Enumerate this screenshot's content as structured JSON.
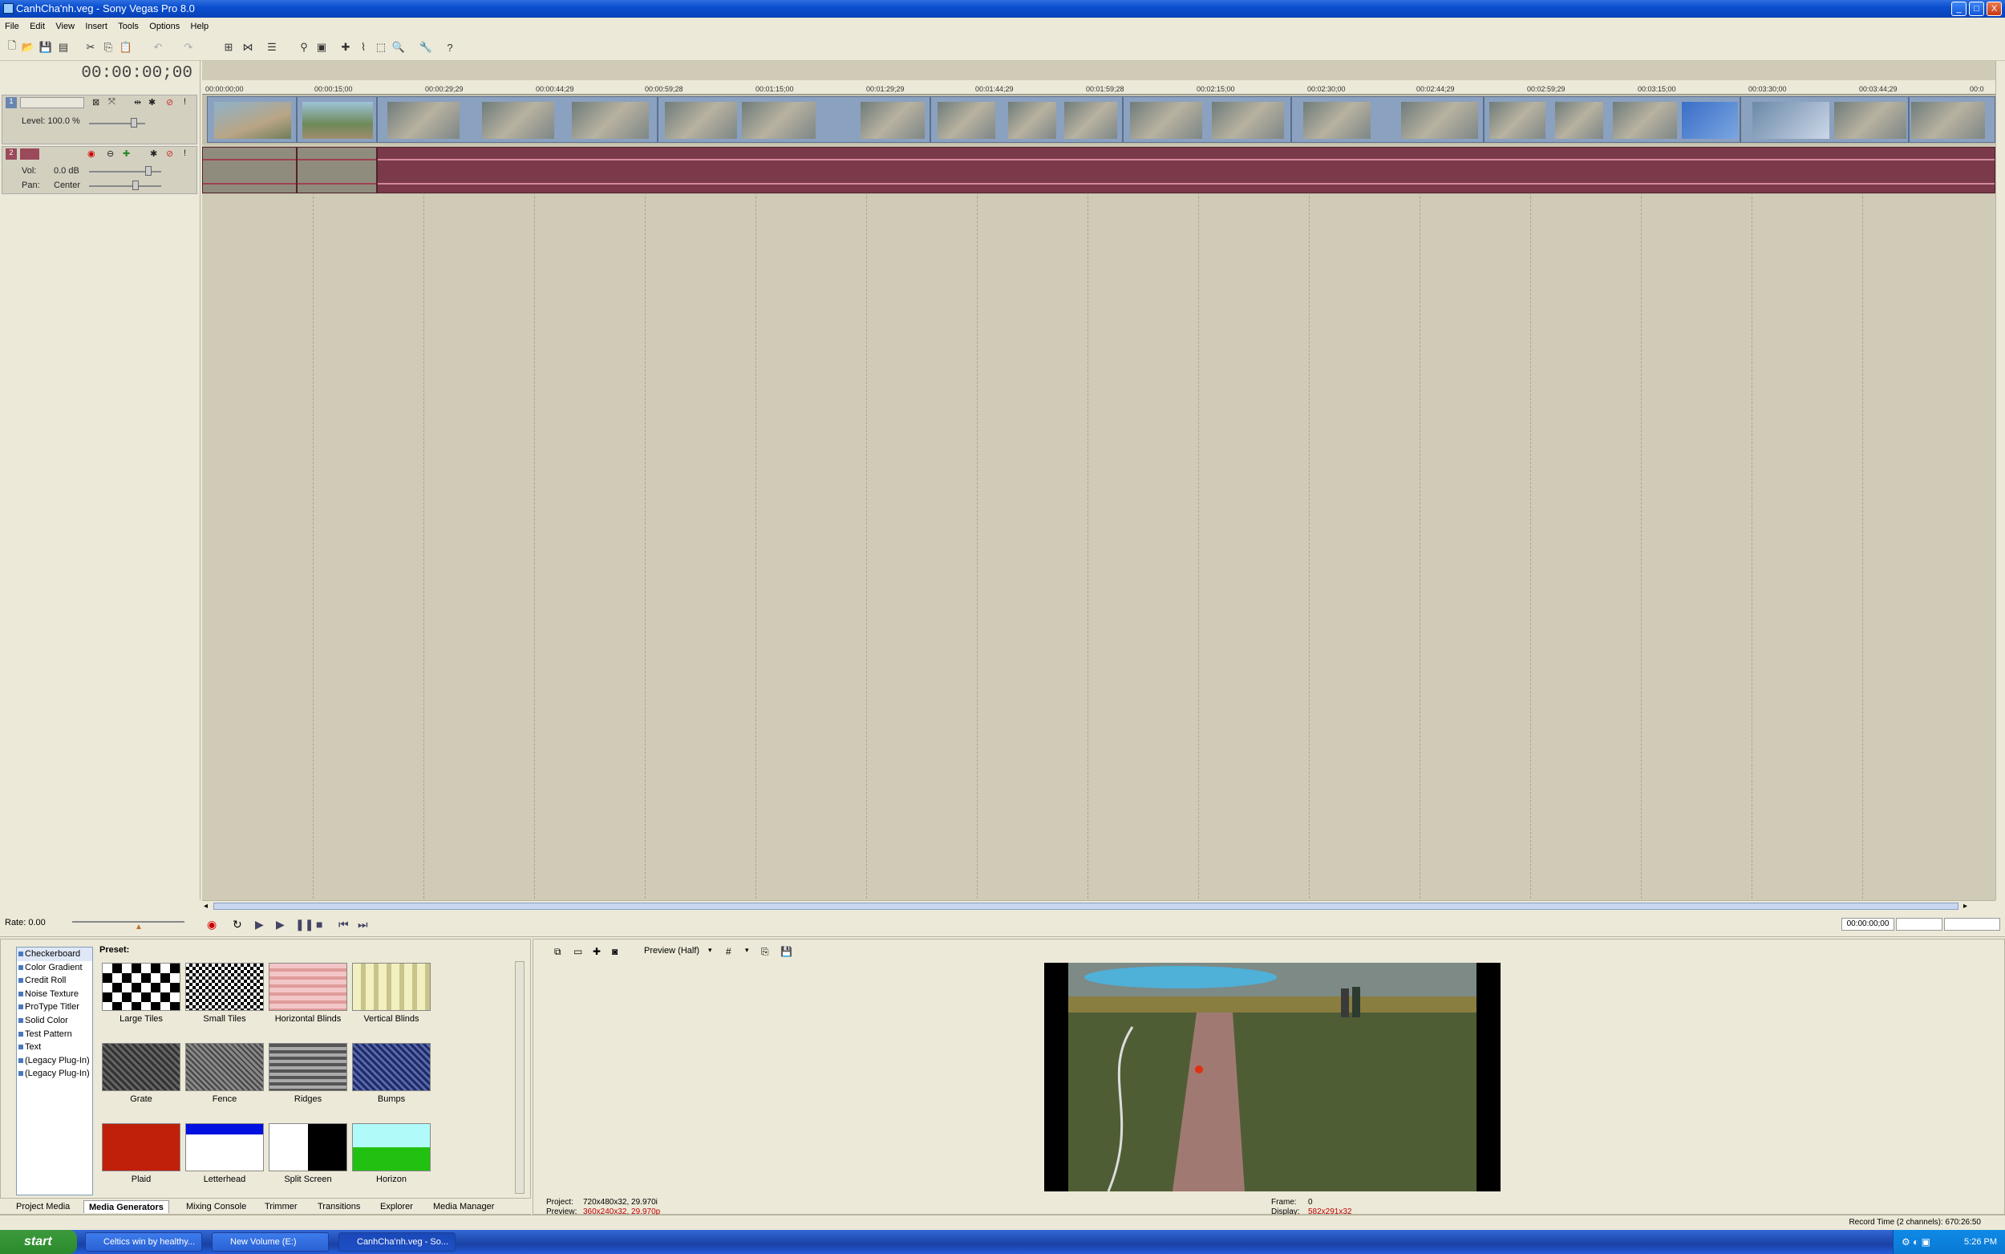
{
  "window": {
    "title": "CanhCha'nh.veg - Sony Vegas Pro 8.0",
    "minimize": "_",
    "maximize": "□",
    "close": "X"
  },
  "menu": [
    "File",
    "Edit",
    "View",
    "Insert",
    "Tools",
    "Options",
    "Help"
  ],
  "timeline": {
    "cursor_time": "00:00:00;00",
    "ruler_ticks": [
      "00:00:00;00",
      "00:00:15;00",
      "00:00:29;29",
      "00:00:44;29",
      "00:00:59;28",
      "00:01:15;00",
      "00:01:29;29",
      "00:01:44;29",
      "00:01:59;28",
      "00:02:15;00",
      "00:02:30;00",
      "00:02:44;29",
      "00:02:59;29",
      "00:03:15;00",
      "00:03:30;00",
      "00:03:44;29",
      "00:0"
    ],
    "video_track": {
      "number": "1",
      "level_label": "Level: 100.0 %"
    },
    "audio_track": {
      "number": "2",
      "vol_label": "Vol:",
      "vol_value": "0.0 dB",
      "pan_label": "Pan:",
      "pan_value": "Center"
    },
    "rate": "Rate: 0.00",
    "end_time": "00:00:00;00"
  },
  "media_generators": {
    "list": [
      "Checkerboard",
      "Color Gradient",
      "Credit Roll",
      "Noise Texture",
      "ProType Titler",
      "Solid Color",
      "Test Pattern",
      "Text",
      "(Legacy Plug-In) T",
      "(Legacy Plug-In) V"
    ],
    "preset_label": "Preset:",
    "presets": [
      "Large Tiles",
      "Small Tiles",
      "Horizontal Blinds",
      "Vertical Blinds",
      "Grate",
      "Fence",
      "Ridges",
      "Bumps",
      "Plaid",
      "Letterhead",
      "Split Screen",
      "Horizon"
    ]
  },
  "tabs": [
    "Project Media",
    "Media Generators",
    "Mixing Console",
    "Trimmer",
    "Transitions",
    "Explorer",
    "Media Manager"
  ],
  "active_tab": "Media Generators",
  "preview": {
    "mode": "Preview (Half)",
    "project_label": "Project:",
    "project_value": "720x480x32, 29.970i",
    "preview_label": "Preview:",
    "preview_value": "360x240x32, 29.970p",
    "frame_label": "Frame:",
    "frame_value": "0",
    "display_label": "Display:",
    "display_value": "582x291x32"
  },
  "status": {
    "record_time": "Record Time (2 channels): 670:26:50"
  },
  "taskbar": {
    "start": "start",
    "items": [
      "Celtics win by healthy...",
      "New Volume (E:)",
      "CanhCha'nh.veg - So..."
    ],
    "clock": "5:26 PM"
  },
  "colors": {
    "video_clip": "#8ba1c0",
    "audio_clip": "#7a3a4a",
    "timeline_bg": "#cfcbb6",
    "titlebar": "#0a4fd0"
  }
}
